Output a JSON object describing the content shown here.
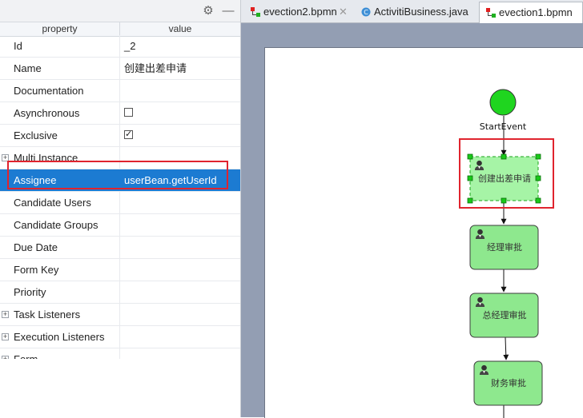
{
  "props": {
    "header": {
      "property": "property",
      "value": "value"
    },
    "toolbar_icons": [
      "gear-icon",
      "minimize-icon"
    ],
    "rows": [
      {
        "name": "Id",
        "value": "_2",
        "expandable": false,
        "kind": "text"
      },
      {
        "name": "Name",
        "value": "创建出差申请",
        "expandable": false,
        "kind": "text"
      },
      {
        "name": "Documentation",
        "value": "",
        "expandable": false,
        "kind": "text"
      },
      {
        "name": "Asynchronous",
        "value": "",
        "expandable": false,
        "kind": "checkbox",
        "checked": false
      },
      {
        "name": "Exclusive",
        "value": "",
        "expandable": false,
        "kind": "checkbox",
        "checked": true
      },
      {
        "name": "Multi Instance",
        "value": "",
        "expandable": true,
        "kind": "text"
      },
      {
        "name": "Assignee",
        "value": "userBean.getUserId",
        "expandable": false,
        "kind": "text",
        "selected": true
      },
      {
        "name": "Candidate Users",
        "value": "",
        "expandable": false,
        "kind": "text"
      },
      {
        "name": "Candidate Groups",
        "value": "",
        "expandable": false,
        "kind": "text"
      },
      {
        "name": "Due Date",
        "value": "",
        "expandable": false,
        "kind": "text"
      },
      {
        "name": "Form Key",
        "value": "",
        "expandable": false,
        "kind": "text"
      },
      {
        "name": "Priority",
        "value": "",
        "expandable": false,
        "kind": "text"
      },
      {
        "name": "Task Listeners",
        "value": "",
        "expandable": true,
        "kind": "text"
      },
      {
        "name": "Execution Listeners",
        "value": "",
        "expandable": true,
        "kind": "text"
      },
      {
        "name": "Form",
        "value": "",
        "expandable": true,
        "kind": "text"
      }
    ]
  },
  "tabs": [
    {
      "label": "evection2.bpmn",
      "icon": "bpmn-file-icon",
      "active": false
    },
    {
      "label": "ActivitiBusiness.java",
      "icon": "java-class-icon",
      "active": false
    },
    {
      "label": "evection1.bpmn",
      "icon": "bpmn-file-icon",
      "active": true
    }
  ],
  "diagram": {
    "start_event": {
      "label": "StartEvent"
    },
    "tasks": [
      {
        "label": "创建出差申请",
        "selected": true,
        "icon": "user-task-icon"
      },
      {
        "label": "经理审批",
        "selected": false,
        "icon": "user-task-icon"
      },
      {
        "label": "总经理审批",
        "selected": false,
        "icon": "user-task-icon"
      },
      {
        "label": "财务审批",
        "selected": false,
        "icon": "user-task-icon"
      }
    ],
    "colors": {
      "start_fill": "#1fd51f",
      "task_fill": "#8ee88e",
      "task_fill_selected": "#a6f4a6",
      "task_border": "#3c3c3c",
      "handle": "#19c919",
      "highlight_red": "#e0242e",
      "selection_blue": "#1c7bd2"
    }
  }
}
